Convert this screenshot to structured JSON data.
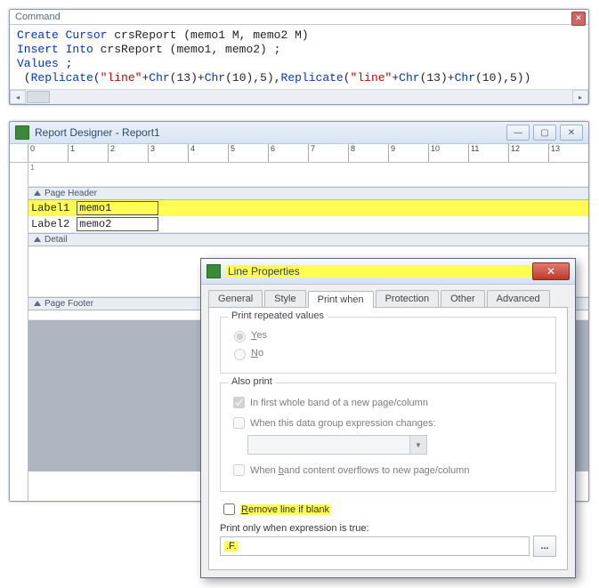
{
  "command": {
    "title": "Command",
    "code_tokens": [
      {
        "t": "Create ",
        "c": "kw"
      },
      {
        "t": "Cursor ",
        "c": "kw"
      },
      {
        "t": "crsReport (memo1 M, memo2 M)\n"
      },
      {
        "t": "Insert ",
        "c": "kw"
      },
      {
        "t": "Into ",
        "c": "kw"
      },
      {
        "t": "crsReport (memo1, memo2) ;\n"
      },
      {
        "t": "Values ",
        "c": "kw"
      },
      {
        "t": ";\n"
      },
      {
        "t": " ("
      },
      {
        "t": "Replicate",
        "c": "kw"
      },
      {
        "t": "("
      },
      {
        "t": "\"line\"",
        "c": "str"
      },
      {
        "t": "+"
      },
      {
        "t": "Chr",
        "c": "kw"
      },
      {
        "t": "(13)+"
      },
      {
        "t": "Chr",
        "c": "kw"
      },
      {
        "t": "(10),5),"
      },
      {
        "t": "Replicate",
        "c": "kw"
      },
      {
        "t": "("
      },
      {
        "t": "\"line\"",
        "c": "str"
      },
      {
        "t": "+"
      },
      {
        "t": "Chr",
        "c": "kw"
      },
      {
        "t": "(13)+"
      },
      {
        "t": "Chr",
        "c": "kw"
      },
      {
        "t": "(10),5))"
      }
    ]
  },
  "designer": {
    "title": "Report Designer - Report1",
    "bands": {
      "page_header": "Page Header",
      "detail": "Detail",
      "page_footer": "Page Footer"
    },
    "row1": {
      "label": "Label1",
      "field": "memo1"
    },
    "row2": {
      "label": "Label2",
      "field": "memo2"
    },
    "ruler": [
      "0",
      "1",
      "2",
      "3",
      "4",
      "5",
      "6",
      "7",
      "8",
      "9",
      "10",
      "11",
      "12",
      "13"
    ]
  },
  "dialog": {
    "title": "Line Properties",
    "tabs": [
      "General",
      "Style",
      "Print when",
      "Protection",
      "Other",
      "Advanced"
    ],
    "active_tab": 2,
    "group1": {
      "title": "Print repeated values",
      "yes": "Yes",
      "no": "No"
    },
    "group2": {
      "title": "Also print",
      "opt1": "In first whole band of a new page/column",
      "opt2": "When this data group expression changes:",
      "opt3": "When band content overflows to new page/column"
    },
    "remove_blank": "Remove line if blank",
    "print_when_label": "Print only when expression is true:",
    "expression": ".F.",
    "ellipsis": "..."
  }
}
